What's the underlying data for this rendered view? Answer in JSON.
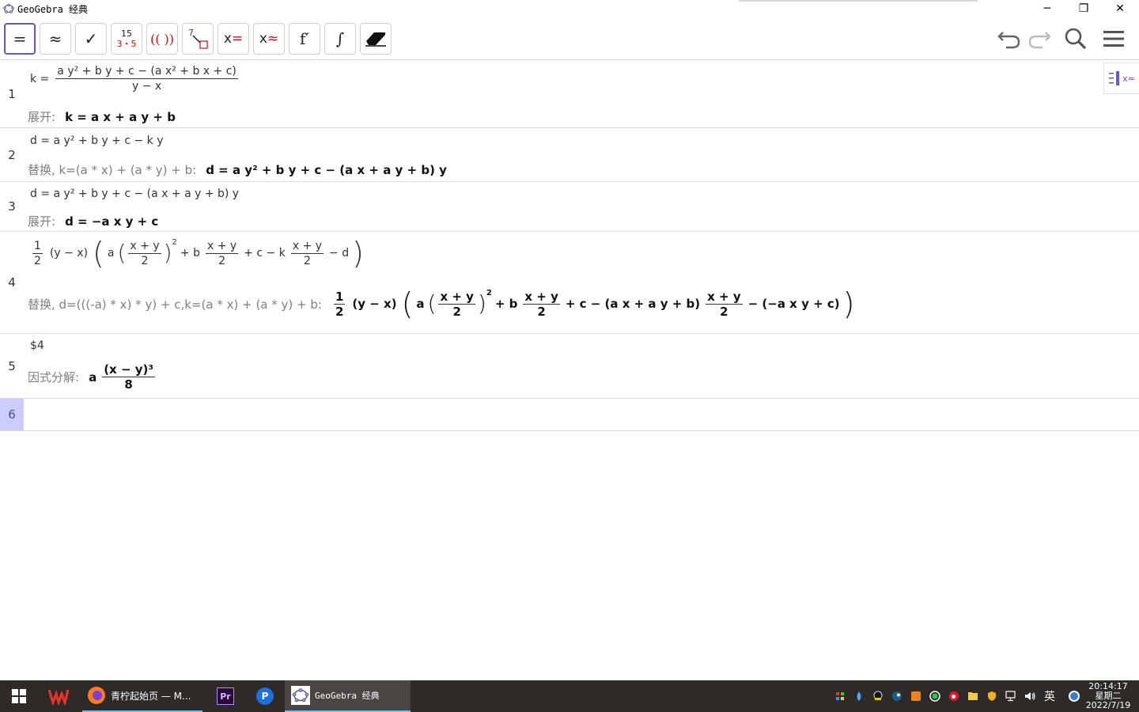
{
  "window": {
    "title": "GeoGebra 经典",
    "minimize": "─",
    "restore": "❐",
    "close": "✕"
  },
  "toolbar": {
    "tools": [
      {
        "name": "evaluate",
        "label": "="
      },
      {
        "name": "numeric",
        "label": "≈"
      },
      {
        "name": "keep-input",
        "label": "✓"
      },
      {
        "name": "factor",
        "top": "15",
        "bottom": "3・5"
      },
      {
        "name": "expand",
        "label": "(( ))"
      },
      {
        "name": "substitute",
        "label": "7"
      },
      {
        "name": "solve",
        "label": "x="
      },
      {
        "name": "solve-numerically",
        "label": "x≈"
      },
      {
        "name": "derivative",
        "label": "f′"
      },
      {
        "name": "integral",
        "label": "∫"
      },
      {
        "name": "delete",
        "label": ""
      }
    ]
  },
  "rows": [
    {
      "num": "1",
      "input": {
        "lhs": "k =",
        "num": "a y² + b y + c − (a x² + b x + c)",
        "den": "y − x"
      },
      "output_label": "展开:",
      "output": "k = a x + a y + b"
    },
    {
      "num": "2",
      "input": "d = a y² + b y + c − k y",
      "output_label": "替换, k=(a * x) + (a * y) + b:",
      "output": "d = a y² + b y + c − (a x + a y + b) y"
    },
    {
      "num": "3",
      "input": "d = a y² + b y + c − (a x + a y + b) y",
      "output_label": "展开:",
      "output": "d = −a x y + c"
    },
    {
      "num": "4",
      "input": {
        "half_num": "1",
        "half_den": "2",
        "a": "(y − x)",
        "b1": "a",
        "xy_num": "x + y",
        "xy_den": "2",
        "sq": "2",
        "b2": "+ b",
        "b3": "+ c − k",
        "b4": "− d"
      },
      "output_label": "替换, d=(((-a) * x) * y) + c,k=(a * x) + (a * y) + b:",
      "output": {
        "half_num": "1",
        "half_den": "2",
        "a": "(y − x)",
        "b1": "a",
        "xy_num": "x + y",
        "xy_den": "2",
        "sq": "2",
        "b2": "+ b",
        "b3": "+ c − (a x + a y + b)",
        "b4": "− (−a x y + c)"
      }
    },
    {
      "num": "5",
      "input": "$4",
      "output_label": "因式分解:",
      "output": {
        "coef": "a",
        "num": "(x − y)³",
        "den": "8"
      }
    },
    {
      "num": "6"
    }
  ],
  "side_button": "x=",
  "taskbar": {
    "firefox_label": "青柠起始页 — M...",
    "geogebra_label": "GeoGebra 经典",
    "ime": "英",
    "time": "20:14:17",
    "weekday": "星期二",
    "date": "2022/7/19"
  },
  "colors": {
    "accent": "#6557d2",
    "row_active": "#ccccff",
    "label_gray": "#7f7f7f",
    "taskbar": "#2e2a28"
  }
}
